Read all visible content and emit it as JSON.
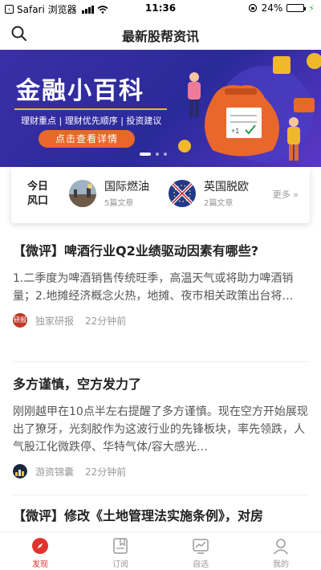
{
  "status_bar": {
    "back_app": "Safari 浏览器",
    "time": "11:36",
    "battery": "24%",
    "battery_level": 0.24
  },
  "nav": {
    "title": "最新股帮资讯",
    "search_icon": "search-icon"
  },
  "banner": {
    "title": "金融小百科",
    "subtitle": "理财重点 | 理财优先顺序 | 投资建议",
    "button": "点击查看详情",
    "slide_count": 3,
    "active_slide": 1
  },
  "topics": {
    "today_line1": "今日",
    "today_line2": "风口",
    "items": [
      {
        "name": "国际燃油",
        "count": "5篇文章"
      },
      {
        "name": "英国脱欧",
        "count": "2篇文章"
      }
    ],
    "more": "更多 »"
  },
  "articles": [
    {
      "title": "【微评】啤酒行业Q2业绩驱动因素有哪些?",
      "summary": "1.二季度为啤酒销售传统旺季，高温天气或将助力啤酒销量；2.地摊经济概念火热，地摊、夜市相关政策出台将…",
      "avatar_text": "研报",
      "source": "独家研报",
      "time": "22分钟前"
    },
    {
      "title": "多方谨慎，空方发力了",
      "summary": "刚刚越甲在10点半左右提醒了多方谨慎。现在空方开始展现出了獠牙，光刻胶作为这波行业的先锋板块，率先领跌，人气股江化微跌停、华特气体/容大感光…",
      "avatar_text": "",
      "source": "游资锦囊",
      "time": "22分钟前"
    },
    {
      "title": "【微评】修改《土地管理法实施条例》，对房",
      "summary": "",
      "avatar_text": "",
      "source": "",
      "time": ""
    }
  ],
  "tabs": [
    {
      "label": "发现",
      "icon": "compass-icon",
      "active": true
    },
    {
      "label": "订阅",
      "icon": "subscribe-icon",
      "active": false
    },
    {
      "label": "自选",
      "icon": "chart-icon",
      "active": false
    },
    {
      "label": "我的",
      "icon": "profile-icon",
      "active": false
    }
  ],
  "colors": {
    "accent": "#e0332d",
    "banner_bg": "#2f2aa0",
    "banner_button": "#e9672b",
    "banner_gold": "#f0b82c"
  }
}
